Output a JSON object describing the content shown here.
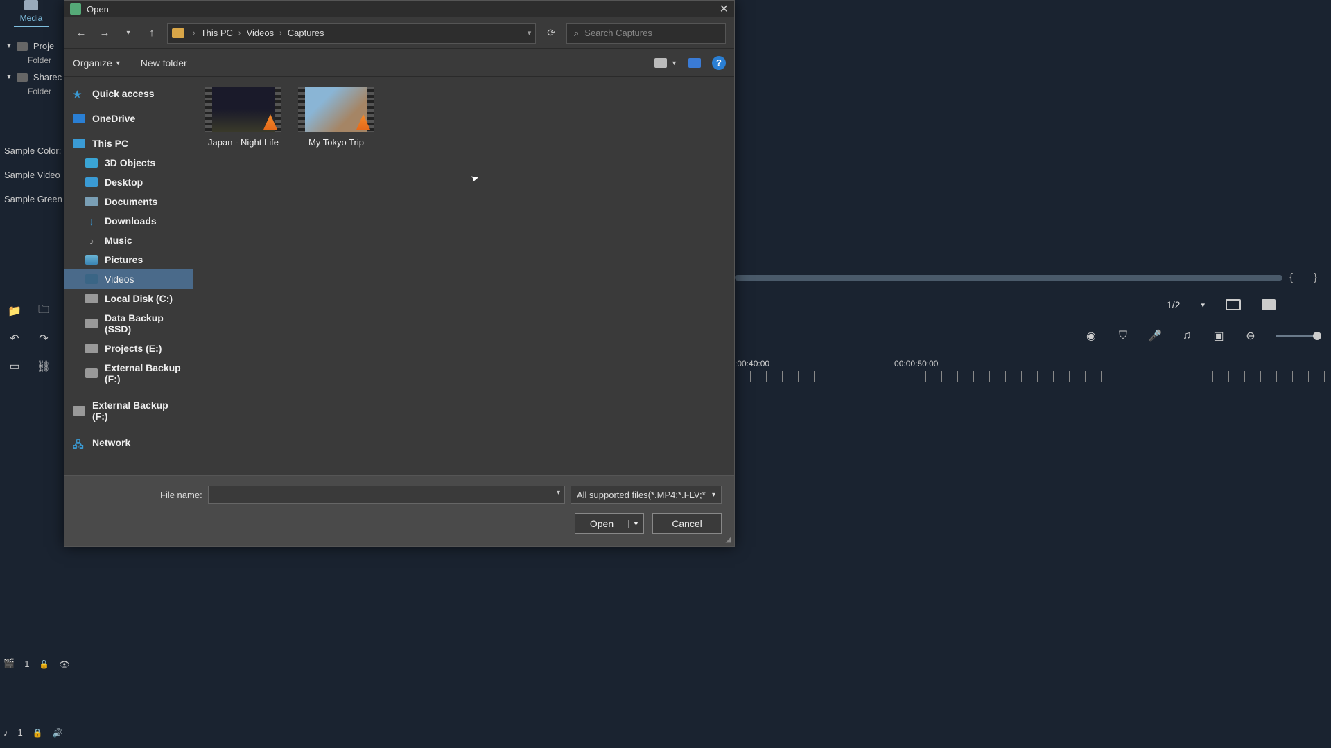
{
  "bg": {
    "media_tab": "Media",
    "tree": {
      "proj": "Proje",
      "shared": "Sharec",
      "folder": "Folder"
    },
    "list": [
      "Sample Color:",
      "Sample Video",
      "Sample Green"
    ],
    "track_v": "1",
    "track_a": "1",
    "pager": "1/2",
    "time1": ":00:40:00",
    "time2": "00:00:50:00"
  },
  "dialog": {
    "title": "Open",
    "breadcrumb": [
      "This PC",
      "Videos",
      "Captures"
    ],
    "search_placeholder": "Search Captures",
    "toolbar": {
      "organize": "Organize",
      "newfolder": "New folder"
    },
    "sidebar": {
      "quick": "Quick access",
      "onedrive": "OneDrive",
      "thispc": "This PC",
      "objects3d": "3D Objects",
      "desktop": "Desktop",
      "documents": "Documents",
      "downloads": "Downloads",
      "music": "Music",
      "pictures": "Pictures",
      "videos": "Videos",
      "disk_c": "Local Disk (C:)",
      "disk_d": "Data Backup (SSD)",
      "disk_e": "Projects (E:)",
      "disk_f1": "External Backup (F:)",
      "disk_f2": "External Backup (F:)",
      "network": "Network"
    },
    "files": [
      {
        "name": "Japan - Night Life"
      },
      {
        "name": "My Tokyo Trip"
      }
    ],
    "footer": {
      "filename_label": "File name:",
      "filter": "All supported files(*.MP4;*.FLV;*",
      "open": "Open",
      "cancel": "Cancel"
    }
  }
}
